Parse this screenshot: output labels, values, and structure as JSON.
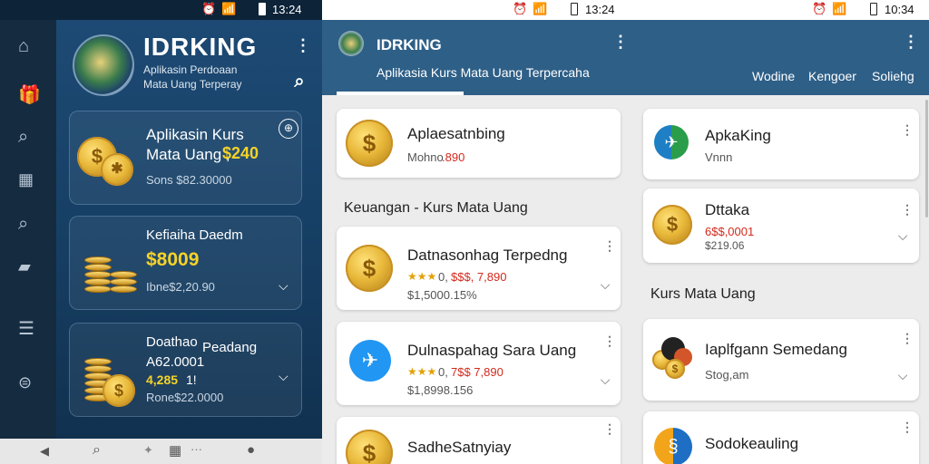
{
  "screens": [
    {
      "status_time": "13:24",
      "app_name": "IDRKING",
      "subtitle_1": "Aplikasin Perdoaan",
      "subtitle_2": "Mata Uang Terperay",
      "cards": [
        {
          "title_1": "Aplikasin Kurs",
          "title_2": "Mata Uang ,",
          "highlight": "$240",
          "sub": "Sons $82.30000"
        },
        {
          "title_1": "Kefiaiha Daedm",
          "highlight": "$8009",
          "sub": "Ibne$2,20.90"
        },
        {
          "title_1": "Doathao",
          "title_side": "Peadang",
          "title_2": "A62.0001",
          "title_3": "4,285",
          "title_3b": "1!",
          "sub": "Rone$22.0000"
        }
      ]
    },
    {
      "status_time": "13:24",
      "app_name": "IDRKING",
      "subtitle": "Aplikasia Kurs Mata Uang Terpercaha",
      "cards": [
        {
          "title": "Aplaesatnbing",
          "sub": "Mohno",
          "sub_red": ".890"
        },
        {
          "title": "Datnasonhag Terpedng",
          "rating": "0,",
          "value_red": "$$$, 7,890",
          "sub": "$1,5000.15%"
        },
        {
          "title": "Dulnaspahag Sara Uang",
          "rating": "0,",
          "value_red": "7$$ 7,890",
          "sub": "$1,8998.156"
        },
        {
          "title": "SadheSatnyiay"
        }
      ],
      "section_title": "Keuangan - Kurs Mata Uang"
    },
    {
      "status_time": "10:34",
      "tabs": [
        "Wodine",
        "Kengoer",
        "Soliehg"
      ],
      "cards": [
        {
          "title": "ApkaKing",
          "sub": "Vnnn"
        },
        {
          "title": "Dttaka",
          "value_red": "6$$,0001",
          "sub": "$219.06"
        },
        {
          "title": "Iaplfgann Semedang",
          "sub": "Stog,am"
        },
        {
          "title": "Sodokeauling"
        }
      ],
      "section_title": "Kurs Mata Uang"
    }
  ],
  "colors": {
    "accent_gold": "#f5d327",
    "price_red": "#d22a1c",
    "header_blue": "#2e5f87",
    "dark_bg": "#0f2c4a"
  }
}
